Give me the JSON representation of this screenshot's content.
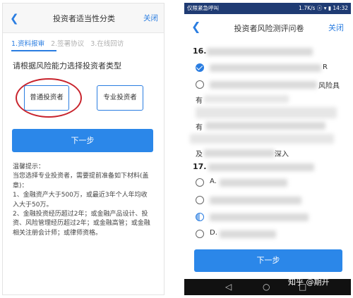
{
  "left": {
    "header": {
      "back_icon": "chevron-left-icon",
      "title": "投资者适当性分类",
      "close_label": "关闭"
    },
    "steps": [
      "1.资料报审",
      "2.签署协议",
      "3.在线回访"
    ],
    "prompt": "请根据风险能力选择投资者类型",
    "types": {
      "normal": "普通投资者",
      "professional": "专业投资者"
    },
    "next_label": "下一步",
    "tips": [
      "温馨提示：",
      "当您选择专业投资者，需要提前准备如下材料(盖章)：",
      "1、金融资产大于500万，或最近3年个人年均收入大于50万。",
      "2、金融投资经历超过2年；或金融产品设计、投资、风险管理经历超过2年；或金融相关注册会计师；或律师资格。"
    ],
    "tips_lines": [
      "温馨提示：",
      "当您选择专业投资者，需要提前准备如下材料(盖",
      "章)：",
      "1、金融资产大于500万，或最近3年个人年均收",
      "入大于50万。",
      "2、金融投资经历超过2年；或金融产品设计、投",
      "资、风险管理经历超过2年；或金融高管；或金融",
      "相关注册会计师；或律师资格。"
    ],
    "accent_color": "#2a7de1",
    "highlight_color": "#c8232c"
  },
  "right": {
    "status": {
      "left": "仅限紧急呼叫",
      "right": "1.7K/s ⓧ ▾ ▮ 14:32"
    },
    "header": {
      "back_icon": "chevron-left-icon",
      "title": "投资者风险测评问卷",
      "close_label": "关闭"
    },
    "q16": {
      "number": "16.",
      "option_end_r": "R",
      "option_end_risk": "风险具",
      "frag_you": "有",
      "frag_you2": "有",
      "frag_ji": "及",
      "frag_shenru": "深入"
    },
    "q17": {
      "number": "17.",
      "opt_a": "A.",
      "opt_d": "D."
    },
    "next_label": "下一步",
    "nav": {
      "back_icon": "triangle-back-icon",
      "home_icon": "circle-home-icon",
      "recent_icon": "square-recent-icon"
    }
  },
  "watermark": "知乎 @期开"
}
